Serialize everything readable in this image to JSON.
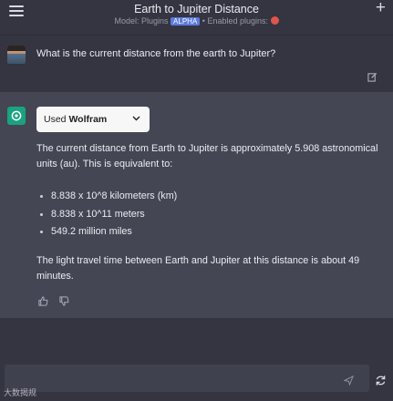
{
  "header": {
    "title": "Earth to Jupiter Distance",
    "model_prefix": "Model: Plugins",
    "model_badge": "ALPHA",
    "plugins_label": "• Enabled plugins:"
  },
  "user_message": {
    "text": "What is the current distance from the earth to Jupiter?"
  },
  "assistant_message": {
    "plugin_used_prefix": "Used",
    "plugin_name": "Wolfram",
    "intro": "The current distance from Earth to Jupiter is approximately 5.908 astronomical units (au). This is equivalent to:",
    "conversions": [
      "8.838 x 10^8 kilometers (km)",
      "8.838 x 10^11 meters",
      "549.2 million miles"
    ],
    "conclusion": "The light travel time between Earth and Jupiter at this distance is about 49 minutes."
  },
  "icons": {
    "menu": "hamburger-icon",
    "new_chat": "plus-icon",
    "edit": "edit-icon",
    "assistant_avatar": "openai-logo-icon",
    "dropdown": "chevron-down-icon",
    "like": "thumbs-up-icon",
    "dislike": "thumbs-down-icon",
    "send": "send-icon",
    "regenerate": "refresh-icon"
  },
  "watermark": {
    "text": "大数揭规"
  },
  "colors": {
    "background": "#343541",
    "assistant_row": "#444654",
    "input": "#40414f",
    "accent_green": "#19a37f",
    "alpha_badge": "#5b7be0"
  }
}
